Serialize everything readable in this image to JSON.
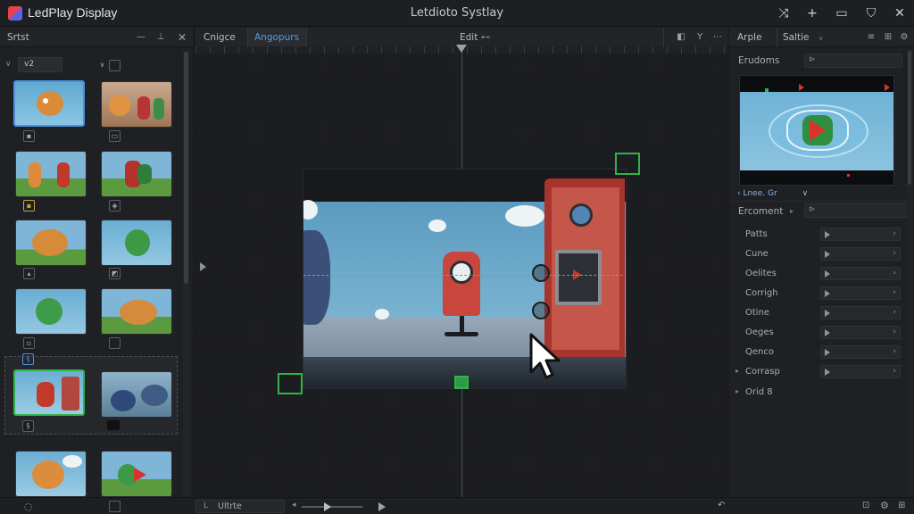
{
  "window": {
    "app_name": "LedPlay Display",
    "title": "Letdioto Systlay"
  },
  "titlebar_icons": [
    "collapse-icon",
    "plus-icon",
    "save-icon",
    "shield-icon",
    "close-icon"
  ],
  "left_panel": {
    "title": "Srtst",
    "filter_value": "v2"
  },
  "center": {
    "tabs": [
      {
        "label": "Cnigce",
        "active": false
      },
      {
        "label": "Angopurs",
        "active": true
      }
    ],
    "edit_label": "Edit",
    "edit_arrow": "⊷"
  },
  "right_panel": {
    "tabs": [
      {
        "label": "Arple"
      },
      {
        "label": "Saltie"
      }
    ],
    "section1_label": "Erudoms",
    "preview_caption": "Lnee. Gr",
    "section2_label": "Ercoment",
    "properties": [
      {
        "label": "Patts"
      },
      {
        "label": "Cune"
      },
      {
        "label": "Oelites"
      },
      {
        "label": "Corrigh"
      },
      {
        "label": "Otine"
      },
      {
        "label": "Oeges"
      },
      {
        "label": "Qenco"
      },
      {
        "label": "Corrasp"
      },
      {
        "label": "Orid 8"
      }
    ]
  },
  "statusbar": {
    "timeline_label": "Ultrte"
  },
  "colors": {
    "accent_blue": "#4a90e2",
    "selection_green": "#2fb34a",
    "play_red": "#d9342b"
  }
}
